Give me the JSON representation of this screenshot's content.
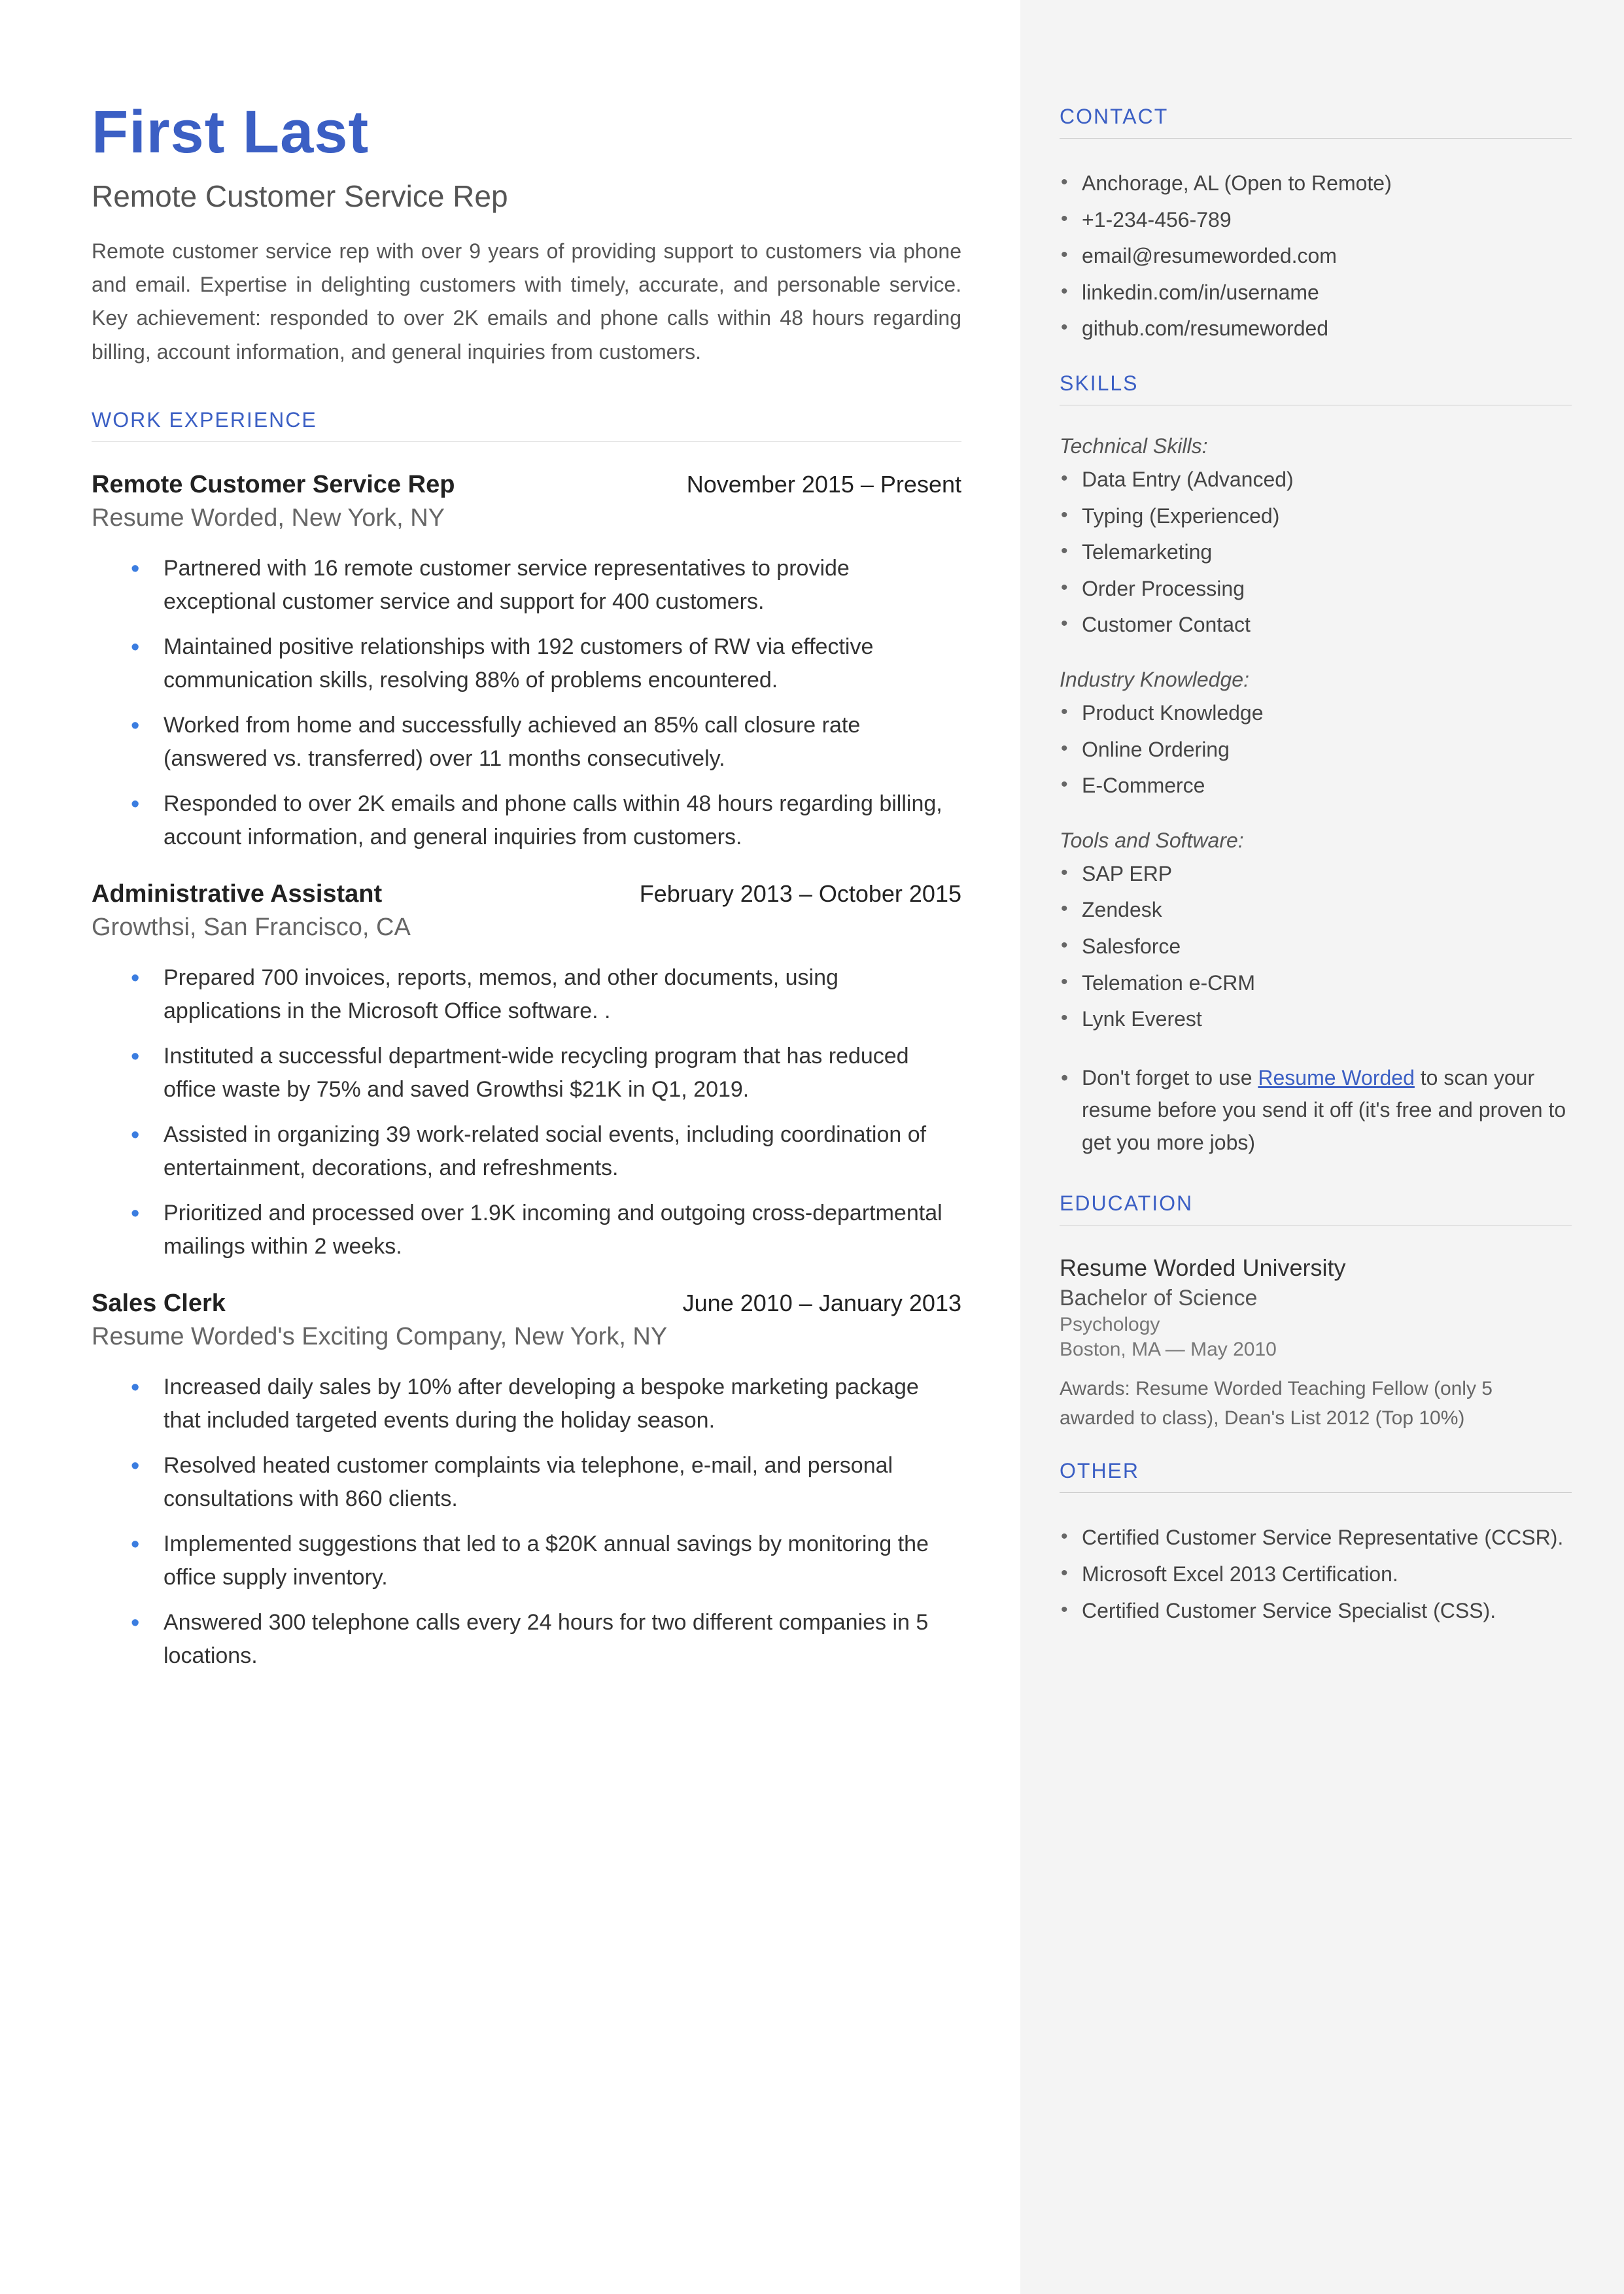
{
  "name": "First Last",
  "title": "Remote Customer Service Rep",
  "summary": "Remote customer service rep with over 9 years of providing support to customers via phone and email. Expertise in delighting customers with timely, accurate, and personable service. Key achievement: responded to over 2K emails and phone calls within 48 hours regarding billing, account information, and general inquiries from customers.",
  "sections": {
    "work": "WORK EXPERIENCE",
    "contact": "CONTACT",
    "skills": "SKILLS",
    "education": "EDUCATION",
    "other": "OTHER"
  },
  "jobs": [
    {
      "title": "Remote Customer Service Rep",
      "dates": "November 2015 – Present",
      "company": "Resume Worded, New York, NY",
      "bullets": [
        "Partnered with 16 remote customer service representatives to provide exceptional customer service and support for 400 customers.",
        "Maintained positive relationships with 192 customers of RW via effective communication skills, resolving 88% of problems encountered.",
        "Worked from home and successfully achieved an 85% call closure rate (answered vs. transferred) over 11 months consecutively.",
        "Responded to over 2K emails and phone calls within 48 hours regarding billing, account information, and general inquiries from customers."
      ]
    },
    {
      "title": "Administrative Assistant",
      "dates": "February 2013 – October 2015",
      "company": "Growthsi, San Francisco, CA",
      "bullets": [
        "Prepared 700 invoices, reports, memos, and other documents, using applications in the Microsoft Office software. .",
        "Instituted a successful department-wide recycling program that has reduced office waste by 75% and saved Growthsi $21K in Q1, 2019.",
        "Assisted in organizing 39 work-related social events, including coordination of entertainment, decorations, and refreshments.",
        "Prioritized and processed over 1.9K incoming and outgoing cross-departmental mailings within 2 weeks."
      ]
    },
    {
      "title": "Sales Clerk",
      "dates": "June 2010 – January 2013",
      "company": "Resume Worded's Exciting Company, New York, NY",
      "bullets": [
        "Increased daily sales by 10% after developing a bespoke marketing package that included targeted events during the holiday season.",
        "Resolved heated customer complaints via telephone, e-mail, and personal consultations with 860 clients.",
        "Implemented suggestions that led to a $20K annual savings by monitoring the office supply inventory.",
        "Answered 300 telephone calls every 24 hours for two different companies in 5 locations."
      ]
    }
  ],
  "contact": [
    "Anchorage, AL (Open to Remote)",
    "+1-234-456-789",
    "email@resumeworded.com",
    "linkedin.com/in/username",
    "github.com/resumeworded"
  ],
  "skills": {
    "groups": [
      {
        "label": "Technical Skills:",
        "items": [
          "Data Entry (Advanced)",
          "Typing (Experienced)",
          "Telemarketing",
          "Order Processing",
          "Customer Contact"
        ]
      },
      {
        "label": "Industry Knowledge:",
        "items": [
          "Product Knowledge",
          "Online Ordering",
          "E-Commerce"
        ]
      },
      {
        "label": "Tools and Software:",
        "items": [
          "SAP ERP",
          "Zendesk",
          "Salesforce",
          "Telemation e-CRM",
          "Lynk Everest"
        ]
      }
    ],
    "note_prefix": "Don't forget to use ",
    "note_link": "Resume Worded",
    "note_suffix": " to scan your resume before you send it off (it's free and proven to get you more jobs)"
  },
  "education": {
    "school": "Resume Worded University",
    "degree": "Bachelor of Science",
    "field": "Psychology",
    "loc": "Boston, MA — May 2010",
    "awards": "Awards: Resume Worded Teaching Fellow (only 5 awarded to class), Dean's List 2012 (Top 10%)"
  },
  "other": [
    "Certified Customer Service Representative (CCSR).",
    "Microsoft Excel 2013 Certification.",
    "Certified Customer Service Specialist (CSS)."
  ]
}
